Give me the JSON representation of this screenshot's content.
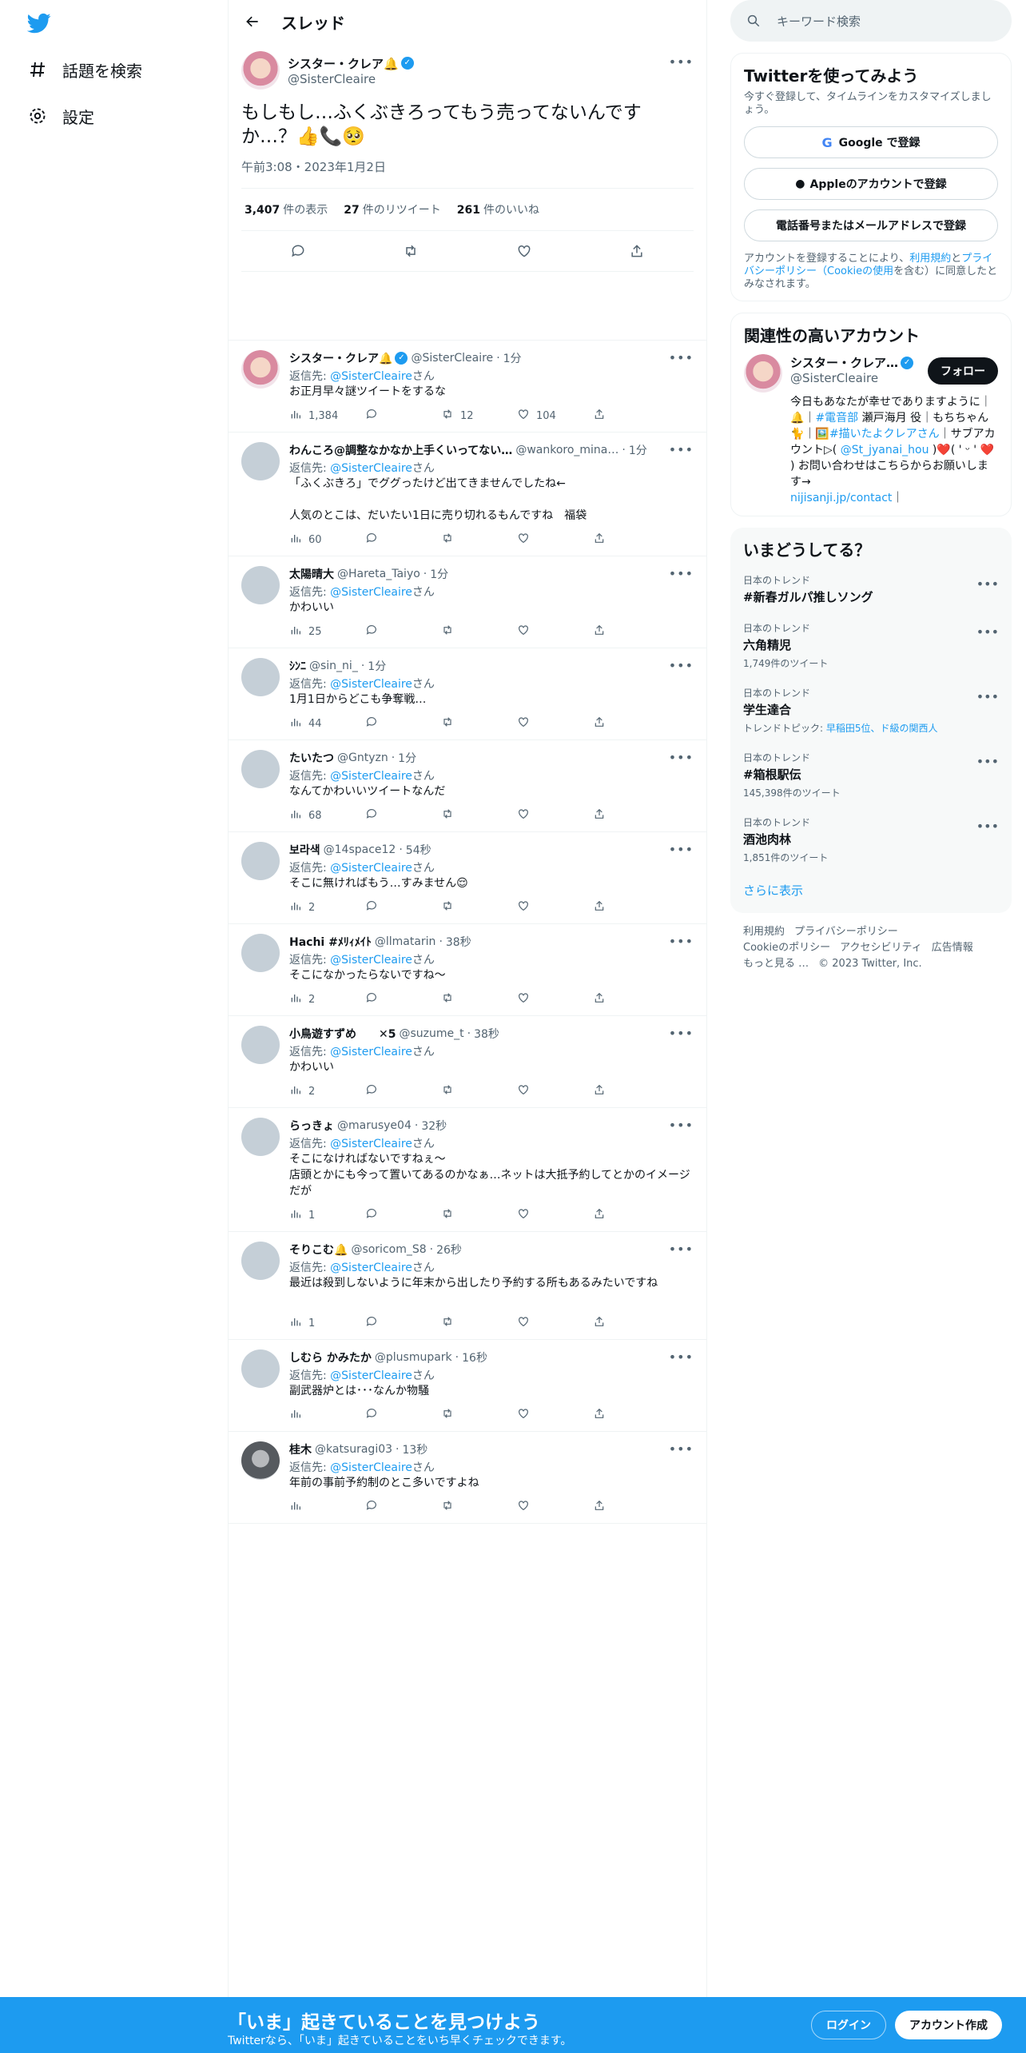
{
  "nav": {
    "explore": "話題を検索",
    "settings": "設定"
  },
  "thread": {
    "title": "スレッド",
    "main": {
      "name": "シスター・クレア🔔",
      "handle": "@SisterCleaire",
      "text": "もしもし…ふくぶきろってもう売ってないんです\nか…？👍📞🥺",
      "time": "午前3:08・2023年1月2日",
      "views_n": "3,407",
      "views_l": "件の表示",
      "rt_n": "27",
      "rt_l": "件のリツイート",
      "likes_n": "261",
      "likes_l": "件のいいね"
    },
    "reply_to_label": "返信先:",
    "reply_to_mention": "@SisterCleaire",
    "reply_to_suffix": "さん",
    "replies": [
      {
        "name": "シスター・クレア🔔",
        "handle": "@SisterCleaire",
        "time": "1分",
        "verified": true,
        "avatar": "pink",
        "text": "お正月早々謎ツイートをするな",
        "views": "1,384",
        "replies": "",
        "rts": "12",
        "likes": "104"
      },
      {
        "name": "わんころ@調整なかなか上手くいってない…",
        "handle": "@wankoro_mina…",
        "time": "1分",
        "avatar": "grey",
        "text": "「ふくぶきろ」でググったけど出てきませんでしたね←\n\n人気のとこは、だいたい1日に売り切れるもんですね　福袋",
        "views": "60",
        "replies": "",
        "rts": "",
        "likes": ""
      },
      {
        "name": "太陽晴大",
        "handle": "@Hareta_Taiyo",
        "time": "1分",
        "avatar": "grey",
        "text": "かわいい",
        "views": "25",
        "replies": "",
        "rts": "",
        "likes": ""
      },
      {
        "name": "ｼﾝﾆ",
        "handle": "@sin_ni_",
        "time": "1分",
        "avatar": "grey",
        "text": "1月1日からどこも争奪戦…",
        "views": "44",
        "replies": "",
        "rts": "",
        "likes": ""
      },
      {
        "name": "たいたつ",
        "handle": "@Gntyzn",
        "time": "1分",
        "avatar": "grey",
        "text": "なんてかわいいツイートなんだ",
        "views": "68",
        "replies": "",
        "rts": "",
        "likes": ""
      },
      {
        "name": "보라색",
        "handle": "@14space12",
        "time": "54秒",
        "avatar": "grey",
        "text": "そこに無ければもう…すみません😌",
        "views": "2",
        "replies": "",
        "rts": "",
        "likes": ""
      },
      {
        "name": "Hachi #ﾒﾘｨﾒｲﾄ",
        "handle": "@llmatarin",
        "time": "38秒",
        "avatar": "grey",
        "text": "そこになかったらないですね～",
        "views": "2",
        "replies": "",
        "rts": "",
        "likes": ""
      },
      {
        "name": "小鳥遊すずめ　　✕5",
        "handle": "@suzume_t",
        "time": "38秒",
        "avatar": "grey",
        "text": "かわいい",
        "views": "2",
        "replies": "",
        "rts": "",
        "likes": ""
      },
      {
        "name": "らっきょ",
        "handle": "@marusye04",
        "time": "32秒",
        "avatar": "grey",
        "text": "そこになければないですねぇ〜\n店頭とかにも今って置いてあるのかなぁ…ネットは大抵予約してとかのイメージだが",
        "views": "1",
        "replies": "",
        "rts": "",
        "likes": ""
      },
      {
        "name": "そりこむ🔔",
        "handle": "@soricom_S8",
        "time": "26秒",
        "avatar": "grey",
        "text": "最近は殺到しないように年末から出したり予約する所もあるみたいですね",
        "views": "1",
        "replies": "",
        "rts": "",
        "likes": "",
        "extra_space": true
      },
      {
        "name": "しむら かみたか",
        "handle": "@plusmupark",
        "time": "16秒",
        "avatar": "grey",
        "text": "副武器炉とは･･･なんか物騒",
        "views": "",
        "replies": "",
        "rts": "",
        "likes": ""
      },
      {
        "name": "桂木",
        "handle": "@katsuragi03",
        "time": "13秒",
        "avatar": "dark",
        "text": "年前の事前予約制のとこ多いですよね",
        "views": "",
        "replies": "",
        "rts": "",
        "likes": ""
      }
    ]
  },
  "right": {
    "search_placeholder": "キーワード検索",
    "signup": {
      "title": "Twitterを使ってみよう",
      "sub": "今すぐ登録して、タイムラインをカスタマイズしましょう。",
      "google": "Google で登録",
      "apple": "Appleのアカウントで登録",
      "phone": "電話番号またはメールアドレスで登録",
      "legal_1": "アカウントを登録することにより、",
      "legal_link1": "利用規約",
      "legal_2": "と",
      "legal_link2": "プライバシーポリシー（Cookieの使用",
      "legal_3": "を含む）に同意したとみなされます。"
    },
    "related": {
      "title": "関連性の高いアカウント",
      "name": "シスター・クレア…",
      "handle": "@SisterCleaire",
      "follow": "フォロー",
      "bio_1": "今日もあなたが幸せでありますように｜🔔｜",
      "bio_tag1": "#電音部",
      "bio_2": " 瀬戸海月 役｜もちちゃん🐈｜🖼️",
      "bio_tag2": "#描いたよクレアさん",
      "bio_3": "｜サブアカウント▷( ",
      "bio_tag3": "@St_jyanai_hou",
      "bio_4": " )❤️( ' ᵕ ' ❤️ ) お問い合わせはこちらからお願いします→",
      "bio_link": "nijisanji.jp/contact",
      "bio_5": "｜"
    },
    "trends": {
      "title": "いまどうしてる？",
      "items": [
        {
          "cat": "日本のトレンド",
          "title": "#新春ガルパ推しソング",
          "count": ""
        },
        {
          "cat": "日本のトレンド",
          "title": "六角精児",
          "count": "1,749件のツイート"
        },
        {
          "cat": "日本のトレンド",
          "title": "学生達合",
          "count_prefix": "トレンドトピック: ",
          "count_link": "早稲田5位、ド級の関西人"
        },
        {
          "cat": "日本のトレンド",
          "title": "#箱根駅伝",
          "count": "145,398件のツイート"
        },
        {
          "cat": "日本のトレンド",
          "title": "酒池肉林",
          "count": "1,851件のツイート"
        }
      ],
      "show_more": "さらに表示"
    },
    "footer": {
      "links1": [
        "利用規約",
        "プライバシーポリシー"
      ],
      "links2": [
        "Cookieのポリシー",
        "アクセシビリティ",
        "広告情報"
      ],
      "links3": [
        "もっと見る …",
        "© 2023 Twitter, Inc."
      ]
    }
  },
  "bottom": {
    "title": "「いま」起きていることを見つけよう",
    "sub": "Twitterなら、「いま」起きていることをいち早くチェックできます。",
    "login": "ログイン",
    "signup": "アカウント作成"
  },
  "colors": {
    "accent": "#1d9bf0",
    "text": "#0f1419",
    "muted": "#536471"
  }
}
